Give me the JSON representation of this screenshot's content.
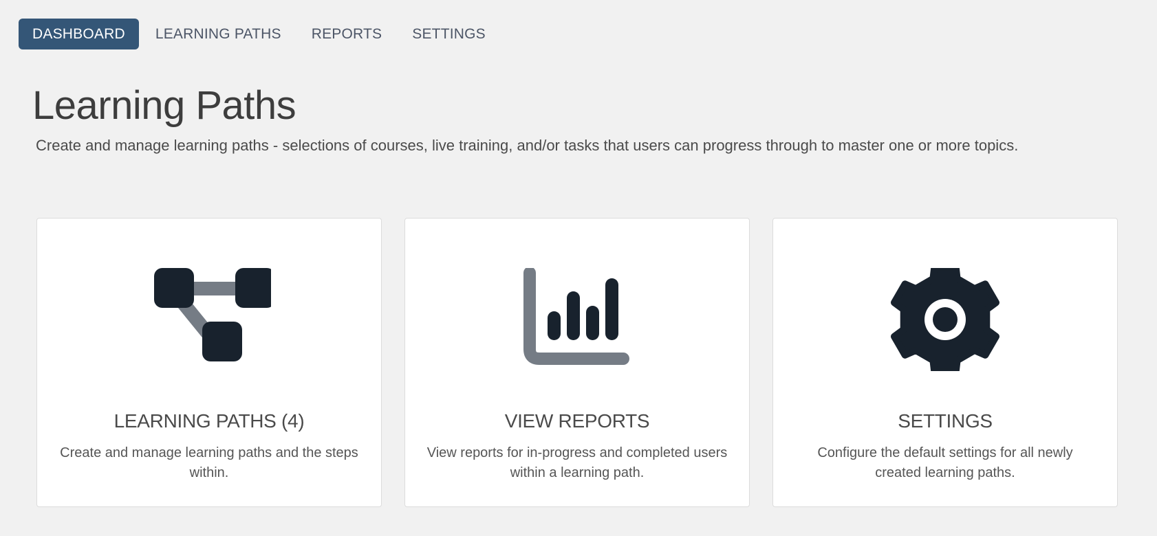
{
  "nav": {
    "items": [
      {
        "label": "DASHBOARD",
        "active": true
      },
      {
        "label": "LEARNING PATHS",
        "active": false
      },
      {
        "label": "REPORTS",
        "active": false
      },
      {
        "label": "SETTINGS",
        "active": false
      }
    ]
  },
  "header": {
    "title": "Learning Paths",
    "subtitle": "Create and manage learning paths - selections of courses, live training, and/or tasks that users can progress through to master one or more topics."
  },
  "cards": [
    {
      "icon": "network-nodes-icon",
      "title": "LEARNING PATHS (4)",
      "description": "Create and manage learning paths and the steps within."
    },
    {
      "icon": "bar-chart-icon",
      "title": "VIEW REPORTS",
      "description": "View reports for in-progress and completed users within a learning path."
    },
    {
      "icon": "gear-icon",
      "title": "SETTINGS",
      "description": "Configure the default settings for all newly created learning paths."
    }
  ],
  "colors": {
    "background": "#f1f1f1",
    "nav_active": "#345677",
    "icon_dark": "#18222d",
    "icon_gray": "#757c85"
  }
}
